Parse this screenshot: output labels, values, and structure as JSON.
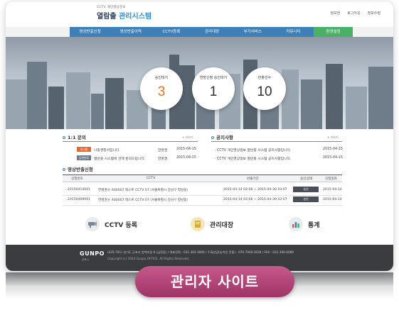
{
  "header": {
    "logo_sub": "CCTV 개인영상정보",
    "logo_title_main": "열람출",
    "logo_title_accent": " 관리시스템",
    "util_links": [
      "정보현",
      "로그아웃",
      "정보수정"
    ]
  },
  "nav": {
    "items": [
      "영상반출신청",
      "영상반출이력",
      "CCTV등록",
      "관리대장",
      "부가서비스",
      "커뮤니티"
    ],
    "env_label": "환경설정"
  },
  "stats": [
    {
      "label": "승인대기",
      "value": "3"
    },
    {
      "label": "연장신청 승인대기",
      "value": "1"
    },
    {
      "label": "반출건수",
      "value": "10"
    }
  ],
  "qna": {
    "title": "1:1 문의",
    "more": "+ 더보기",
    "rows": [
      {
        "badge": "대기중",
        "text": "나출경찰서입니다.",
        "author": "한명권",
        "date": "2015-04-15"
      },
      {
        "badge": "답변완료",
        "text": "열반출 시스템에 관해 문의드립니다.",
        "author": "한명권",
        "date": "2015-04-15"
      }
    ]
  },
  "notice": {
    "title": "공지사항",
    "more": "+ 더보기",
    "rows": [
      {
        "text": "· CCTV 개인영상정보 열반출 시스템 공지사항입니다.",
        "date": "2015-04-15"
      },
      {
        "text": "· CCTV 개인영상정보 열반출 시스템 공지사항입니다.",
        "date": "2015-04-15"
      }
    ]
  },
  "requests": {
    "title": "영상반출신청",
    "headers": [
      "신청번호",
      "CCTV",
      "반출기간",
      "승인상태",
      "신청일자"
    ],
    "rows": [
      {
        "no": "· 20150414001",
        "cctv": "한명권Ⓐ A00007 테스트 CCTV 07 (서울특별시 강남구 청담동)",
        "period": "2015-04-14 02:06 ~ 2015-04-30 03:07",
        "status": "승인",
        "date": "2015-04-14"
      },
      {
        "no": "· 20150409001",
        "cctv": "한명권Ⓐ A00007 테스트 CCTV 07 (서울특별시 강남구 청담동)",
        "period": "2015-04-14 02:06 ~ 2015-04-30 03:07",
        "status": "승인",
        "date": "2015-04-14"
      }
    ]
  },
  "shortcuts": [
    {
      "icon": "cctv-camera-icon",
      "label": "CCTV 등록"
    },
    {
      "icon": "ledger-book-icon",
      "label": "관리대장"
    },
    {
      "icon": "bar-chart-icon",
      "label": "통계"
    }
  ],
  "footer": {
    "logo": "GUNPO",
    "logo_sub": "군포시",
    "address": "(435-701) 경기도 군포시 청백리길 6 (금정동)  /  대표전화 : 031-392-3000  /  수화상담(농아인 전용) : 070-7949-3939  /  FAX : 031-390-0089",
    "copyright": "Copyright (c) 2014 Gunpo OFFICE. All Rights Reserved."
  },
  "banner": {
    "text": "관리자 사이트"
  },
  "colors": {
    "nav_blue": "#3d7fb6",
    "nav_green": "#4ab065",
    "accent_orange": "#e8742a",
    "banner": "#b04878"
  }
}
